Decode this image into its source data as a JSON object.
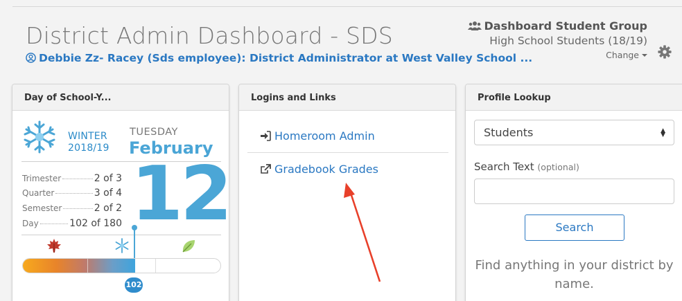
{
  "header": {
    "title": "District Admin Dashboard - SDS",
    "user_line": "Debbie Zz- Racey (Sds employee): District Administrator at West Valley School ..."
  },
  "group": {
    "title": "Dashboard Student Group",
    "subtitle": "High School Students (18/19)",
    "change_label": "Change"
  },
  "day_panel": {
    "title": "Day of School-Y...",
    "season_name": "WINTER",
    "school_year": "2018/19",
    "weekday": "TUESDAY",
    "month": "February",
    "day_number": "12",
    "stats": [
      {
        "label": "Trimester",
        "value": "2 of 3"
      },
      {
        "label": "Quarter",
        "value": "3 of 4"
      },
      {
        "label": "Semester",
        "value": "2 of 2"
      },
      {
        "label": "Day",
        "value": "102 of 180"
      }
    ],
    "progress_day": "102",
    "progress_fraction": 0.567,
    "colors": {
      "autumn": "#c0392b",
      "winter": "#4ba6d6",
      "spring": "#8cc152"
    }
  },
  "links_panel": {
    "title": "Logins and Links",
    "links": [
      {
        "label": "Homeroom Admin",
        "icon": "sign-in-icon"
      },
      {
        "label": "Gradebook Grades",
        "icon": "external-link-icon"
      }
    ]
  },
  "lookup_panel": {
    "title": "Profile Lookup",
    "select_value": "Students",
    "search_label": "Search Text",
    "search_label_note": "(optional)",
    "search_value": "",
    "search_button": "Search",
    "hint": "Find anything in your district by name."
  },
  "colors": {
    "link": "#2a78c2",
    "accent": "#4ba6d6",
    "annotation_arrow": "#e8402a"
  }
}
